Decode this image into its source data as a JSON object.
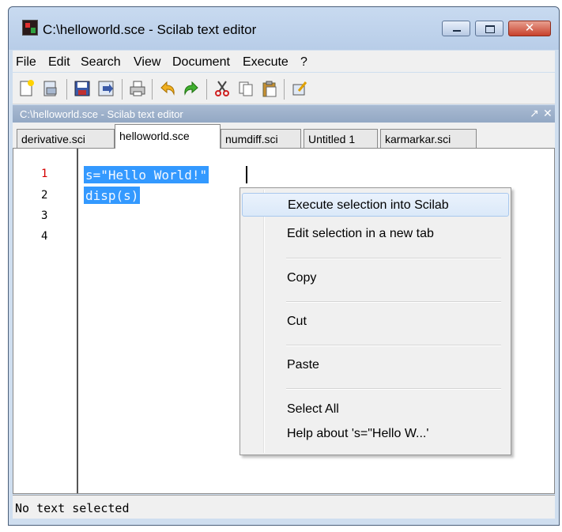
{
  "window": {
    "title": "C:\\helloworld.sce - Scilab text editor",
    "buttons": [
      "minimize",
      "maximize",
      "close"
    ]
  },
  "menubar": [
    "File",
    "Edit",
    "Search",
    "View",
    "Document",
    "Execute",
    "?"
  ],
  "toolbar": {
    "icons": [
      "new-file-icon",
      "open-file-icon",
      "save-icon",
      "save-as-icon",
      "print-icon",
      "undo-icon",
      "redo-icon",
      "cut-icon",
      "copy-icon",
      "paste-icon",
      "execute-icon"
    ]
  },
  "doc_header": {
    "title": "C:\\helloworld.sce - Scilab text editor",
    "undock": "↗",
    "close": "✕"
  },
  "tabs": [
    {
      "label": "derivative.sci",
      "active": false
    },
    {
      "label": "helloworld.sce",
      "active": true
    },
    {
      "label": "numdiff.sci",
      "active": false
    },
    {
      "label": "Untitled 1",
      "active": false
    },
    {
      "label": "karmarkar.sci",
      "active": false
    }
  ],
  "editor": {
    "line_numbers": [
      "1",
      "2",
      "3",
      "4"
    ],
    "lines": [
      "s=\"Hello World!\"",
      "disp(s)",
      "",
      ""
    ]
  },
  "context_menu": {
    "items": [
      "Execute selection into Scilab",
      "Edit selection in a new tab",
      "Copy",
      "Cut",
      "Paste",
      "Select All",
      "Help about 's=\"Hello W...'"
    ]
  },
  "status": "No text selected",
  "colors": {
    "selection": "#3399ff",
    "current_line_number": "#d40000",
    "title_bar": "#c8daf0",
    "doc_header": "#a9bad2"
  }
}
